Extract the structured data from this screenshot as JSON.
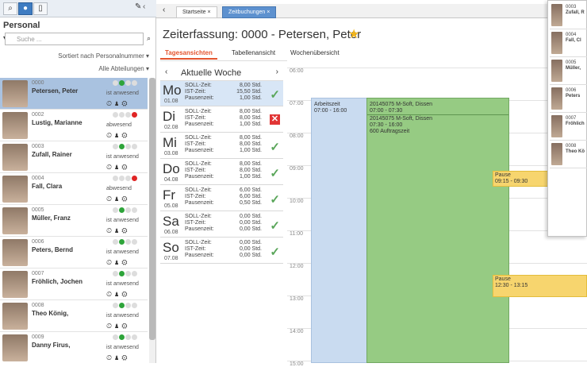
{
  "personal_panel": {
    "title": "Personal",
    "search_placeholder": "Suche ...",
    "sort_label": "Sortiert nach Personalnummer",
    "dept_label": "Alle Abteilungen",
    "people": [
      {
        "num": "0000",
        "name": "Petersen, Peter",
        "status": "ist anwesend",
        "dot": "green",
        "sel": true
      },
      {
        "num": "0002",
        "name": "Lustig, Marianne",
        "status": "abwesend",
        "dot": "red",
        "sel": false
      },
      {
        "num": "0003",
        "name": "Zufall, Rainer",
        "status": "ist anwesend",
        "dot": "green",
        "sel": false
      },
      {
        "num": "0004",
        "name": "Fall, Clara",
        "status": "abwesend",
        "dot": "red",
        "sel": false
      },
      {
        "num": "0005",
        "name": "Müller, Franz",
        "status": "ist anwesend",
        "dot": "green",
        "sel": false
      },
      {
        "num": "0006",
        "name": "Peters, Bernd",
        "status": "ist anwesend",
        "dot": "green",
        "sel": false
      },
      {
        "num": "0007",
        "name": "Fröhlich, Jochen",
        "status": "ist anwesend",
        "dot": "green",
        "sel": false
      },
      {
        "num": "0008",
        "name": "Theo König,",
        "status": "ist anwesend",
        "dot": "green",
        "sel": false
      },
      {
        "num": "0009",
        "name": "Danny Firus,",
        "status": "ist anwesend",
        "dot": "green",
        "sel": false
      }
    ]
  },
  "tabs": {
    "start": "Startseite ×",
    "zeit": "Zeitbuchungen ×"
  },
  "header": {
    "title": "Zeiterfassung: 0000 - Petersen, Peter"
  },
  "view_tabs": [
    "Tagesansichten",
    "Tabellenansicht",
    "Wochenübersicht"
  ],
  "week": {
    "label": "Aktuelle Woche",
    "days": [
      {
        "d": "Mo",
        "date": "01.08",
        "soll": "8,00 Std.",
        "ist": "15,50 Std.",
        "pause": "1,00 Std.",
        "ok": true,
        "sel": true
      },
      {
        "d": "Di",
        "date": "02.08",
        "soll": "8,00 Std.",
        "ist": "8,00 Std.",
        "pause": "1,00 Std.",
        "ok": false,
        "sel": false
      },
      {
        "d": "Mi",
        "date": "03.08",
        "soll": "8,00 Std.",
        "ist": "8,00 Std.",
        "pause": "1,00 Std.",
        "ok": true,
        "sel": false
      },
      {
        "d": "Do",
        "date": "04.08",
        "soll": "8,00 Std.",
        "ist": "8,00 Std.",
        "pause": "1,00 Std.",
        "ok": true,
        "sel": false
      },
      {
        "d": "Fr",
        "date": "05.08",
        "soll": "6,00 Std.",
        "ist": "6,00 Std.",
        "pause": "0,50 Std.",
        "ok": true,
        "sel": false
      },
      {
        "d": "Sa",
        "date": "06.08",
        "soll": "0,00 Std.",
        "ist": "0,00 Std.",
        "pause": "0,00 Std.",
        "ok": true,
        "sel": false
      },
      {
        "d": "So",
        "date": "07.08",
        "soll": "0,00 Std.",
        "ist": "0,00 Std.",
        "pause": "0,00 Std.",
        "ok": true,
        "sel": false
      }
    ],
    "labels": {
      "soll": "SOLL-Zeit:",
      "ist": "IST-Zeit:",
      "pause": "Pausenzeit:"
    }
  },
  "calendar": {
    "hours": [
      "06:00",
      "07:00",
      "08:00",
      "09:00",
      "10:00",
      "11:00",
      "12:00",
      "13:00",
      "14:00",
      "15:00"
    ],
    "work_title": "Arbeitszeit",
    "work_time": "07:00 - 16:00",
    "auftrag1": "20145075 M-Soft, Dissen",
    "auftrag1_time": "07:00 - 07:30",
    "auftrag2": "20145075 M-Soft, Dissen",
    "auftrag2_time": "07:30 - 16:00",
    "auftrag2_sub": "600 Auftragszeit",
    "pause1": "Pause",
    "pause1_time": "09:15 - 09:30",
    "pause2": "Pause",
    "pause2_time": "12:30 - 13:15"
  },
  "popup": [
    {
      "num": "0003",
      "name": "Zufall, R"
    },
    {
      "num": "0004",
      "name": "Fall, Cl"
    },
    {
      "num": "0005",
      "name": "Müller,"
    },
    {
      "num": "0006",
      "name": "Peters"
    },
    {
      "num": "0007",
      "name": "Fröhlich"
    },
    {
      "num": "0008",
      "name": "Theo Kö"
    }
  ]
}
